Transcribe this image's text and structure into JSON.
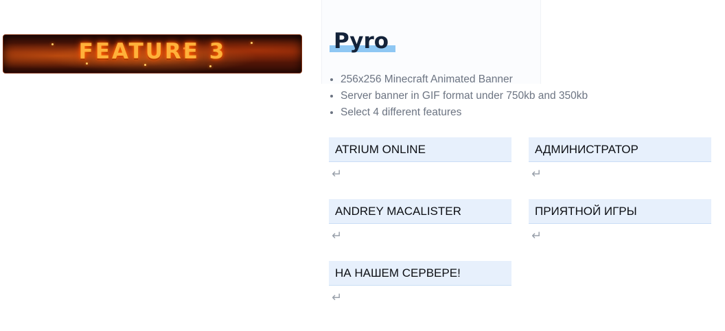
{
  "banner": {
    "text": "FEATURE 3"
  },
  "product": {
    "title": "Pyro",
    "features": [
      "256x256 Minecraft Animated Banner",
      "Server banner in GIF format under 750kb and 350kb",
      "Select 4 different features"
    ]
  },
  "fields": [
    {
      "value": "ATRIUM ONLINE",
      "icon": "enter-icon"
    },
    {
      "value": "АДМИНИСТРАТОР",
      "icon": "enter-icon"
    },
    {
      "value": "ANDREY MACALISTER",
      "icon": "enter-icon"
    },
    {
      "value": "ПРИЯТНОЙ ИГРЫ",
      "icon": "enter-icon"
    },
    {
      "value": "НА НАШЕМ СЕРВЕРЕ!",
      "icon": "enter-icon"
    }
  ],
  "colors": {
    "title_highlight": "#8ec7f3",
    "field_background": "#e7f0fc",
    "title_text": "#132239"
  }
}
